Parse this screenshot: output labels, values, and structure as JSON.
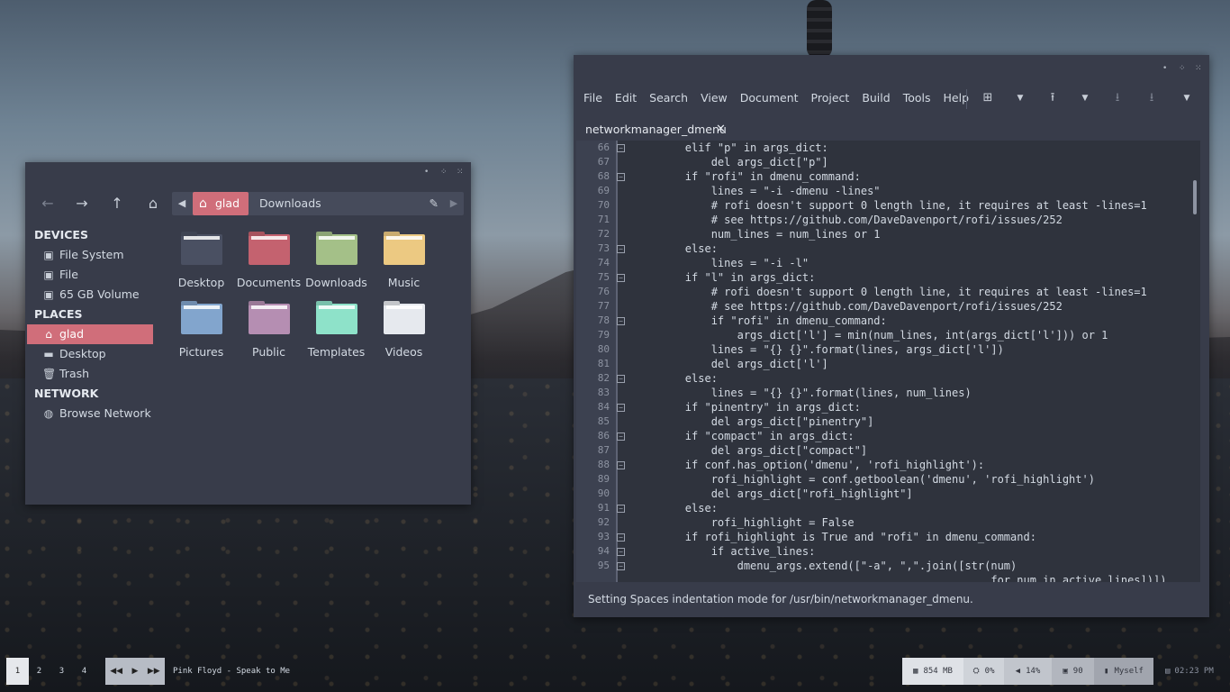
{
  "file_manager": {
    "path_active": "glad",
    "path_next": "Downloads",
    "sections": {
      "devices": "DEVICES",
      "places": "PLACES",
      "network": "NETWORK"
    },
    "devices": [
      "File System",
      "File",
      "65 GB Volume"
    ],
    "places": [
      "glad",
      "Desktop",
      "Trash"
    ],
    "network_items": [
      "Browse Network"
    ],
    "folders": [
      {
        "name": "Desktop",
        "color": "#4a5062"
      },
      {
        "name": "Documents",
        "color": "#c4626f"
      },
      {
        "name": "Downloads",
        "color": "#a4c088"
      },
      {
        "name": "Music",
        "color": "#ecc982"
      },
      {
        "name": "Pictures",
        "color": "#82a5cd"
      },
      {
        "name": "Public",
        "color": "#b58eb2"
      },
      {
        "name": "Templates",
        "color": "#8ee2c9"
      },
      {
        "name": "Videos",
        "color": "#e6e9ee"
      }
    ],
    "accent_color": "#d06e7a"
  },
  "editor": {
    "menu": [
      "File",
      "Edit",
      "Search",
      "View",
      "Document",
      "Project",
      "Build",
      "Tools",
      "Help"
    ],
    "tab_name": "networkmanager_dmenu",
    "status": "Setting Spaces indentation mode for /usr/bin/networkmanager_dmenu.",
    "lines": [
      {
        "n": "66",
        "fold": true,
        "text": "        elif \"p\" in args_dict:"
      },
      {
        "n": "67",
        "fold": false,
        "text": "            del args_dict[\"p\"]"
      },
      {
        "n": "68",
        "fold": true,
        "text": "        if \"rofi\" in dmenu_command:"
      },
      {
        "n": "69",
        "fold": false,
        "text": "            lines = \"-i -dmenu -lines\""
      },
      {
        "n": "70",
        "fold": false,
        "text": "            # rofi doesn't support 0 length line, it requires at least -lines=1"
      },
      {
        "n": "71",
        "fold": false,
        "text": "            # see https://github.com/DaveDavenport/rofi/issues/252"
      },
      {
        "n": "72",
        "fold": false,
        "text": "            num_lines = num_lines or 1"
      },
      {
        "n": "73",
        "fold": true,
        "text": "        else:"
      },
      {
        "n": "74",
        "fold": false,
        "text": "            lines = \"-i -l\""
      },
      {
        "n": "75",
        "fold": true,
        "text": "        if \"l\" in args_dict:"
      },
      {
        "n": "76",
        "fold": false,
        "text": "            # rofi doesn't support 0 length line, it requires at least -lines=1"
      },
      {
        "n": "77",
        "fold": false,
        "text": "            # see https://github.com/DaveDavenport/rofi/issues/252"
      },
      {
        "n": "78",
        "fold": true,
        "text": "            if \"rofi\" in dmenu_command:"
      },
      {
        "n": "79",
        "fold": false,
        "text": "                args_dict['l'] = min(num_lines, int(args_dict['l'])) or 1"
      },
      {
        "n": "80",
        "fold": false,
        "text": "            lines = \"{} {}\".format(lines, args_dict['l'])"
      },
      {
        "n": "81",
        "fold": false,
        "text": "            del args_dict['l']"
      },
      {
        "n": "82",
        "fold": true,
        "text": "        else:"
      },
      {
        "n": "83",
        "fold": false,
        "text": "            lines = \"{} {}\".format(lines, num_lines)"
      },
      {
        "n": "84",
        "fold": true,
        "text": "        if \"pinentry\" in args_dict:"
      },
      {
        "n": "85",
        "fold": false,
        "text": "            del args_dict[\"pinentry\"]"
      },
      {
        "n": "86",
        "fold": true,
        "text": "        if \"compact\" in args_dict:"
      },
      {
        "n": "87",
        "fold": false,
        "text": "            del args_dict[\"compact\"]"
      },
      {
        "n": "88",
        "fold": true,
        "text": "        if conf.has_option('dmenu', 'rofi_highlight'):"
      },
      {
        "n": "89",
        "fold": false,
        "text": "            rofi_highlight = conf.getboolean('dmenu', 'rofi_highlight')"
      },
      {
        "n": "90",
        "fold": false,
        "text": "            del args_dict[\"rofi_highlight\"]"
      },
      {
        "n": "91",
        "fold": true,
        "text": "        else:"
      },
      {
        "n": "92",
        "fold": false,
        "text": "            rofi_highlight = False"
      },
      {
        "n": "93",
        "fold": true,
        "text": "        if rofi_highlight is True and \"rofi\" in dmenu_command:"
      },
      {
        "n": "94",
        "fold": true,
        "text": "            if active_lines:"
      },
      {
        "n": "95",
        "fold": true,
        "text": "                dmenu_args.extend([\"-a\", \",\".join([str(num)"
      },
      {
        "n": "",
        "fold": false,
        "text": "                                                       for num in active_lines])])"
      }
    ]
  },
  "panel": {
    "workspaces": [
      "1",
      "2",
      "3",
      "4"
    ],
    "now_playing": "Pink Floyd - Speak to Me",
    "memory": "854 MB",
    "cpu": "0%",
    "volume": "14%",
    "battery": "90",
    "user": "Myself",
    "time": "02:23 PM"
  }
}
